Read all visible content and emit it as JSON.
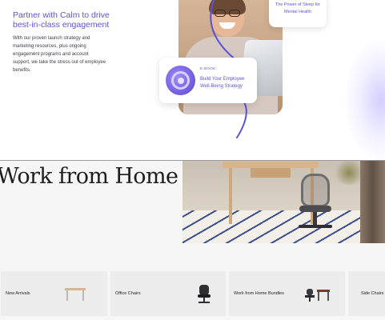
{
  "promo": {
    "headline": "Partner with Calm to drive best-in-class engagement",
    "body": "With our proven launch strategy and marketing resources, plus ongoing engagement programs and account support, we take the stress out of employee benefits.",
    "top_card_title": "The Power of Sleep for Mental Health",
    "ebook_tag": "E-BOOK",
    "ebook_title": "Build Your Employee Well-Being Strategy",
    "accent_color": "#5e54d6"
  },
  "wfh": {
    "title": "Work from Home",
    "categories": [
      {
        "label": "New Arrivals",
        "icon": "desk-thumbnail-icon"
      },
      {
        "label": "Office Chairs",
        "icon": "office-chair-thumbnail-icon"
      },
      {
        "label": "Work from Home Bundles",
        "icon": "bundle-thumbnail-icon"
      },
      {
        "label": "Side Chairs",
        "icon": "side-chair-thumbnail-icon"
      }
    ]
  }
}
